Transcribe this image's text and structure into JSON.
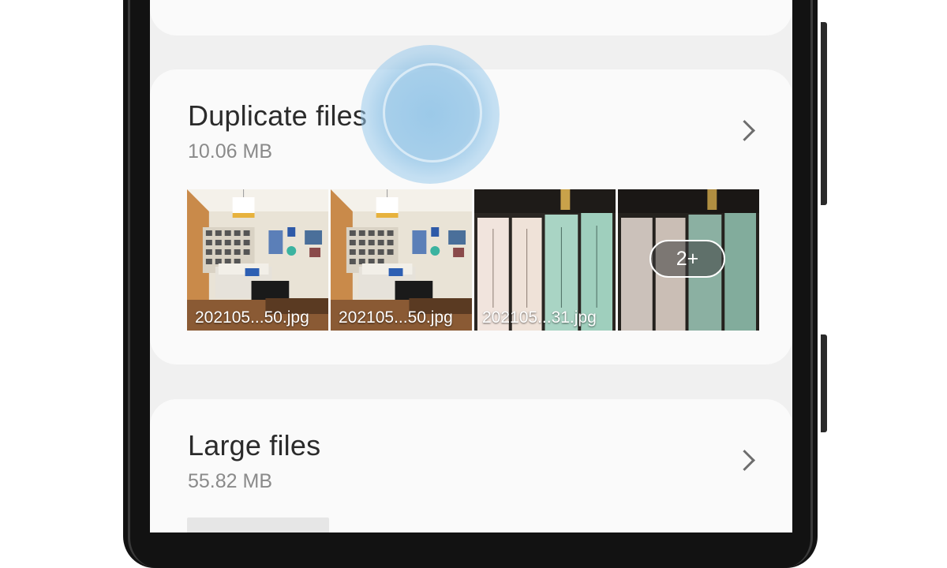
{
  "colors": {
    "screen_bg": "#f0f0f0",
    "card_bg": "#fafafa",
    "title_text": "#2b2b2b",
    "subtitle_text": "#8a8a8a",
    "touch_indicator": "#73b4e1"
  },
  "duplicate_files": {
    "title": "Duplicate files",
    "size": "10.06 MB",
    "thumbnails": [
      {
        "label": "202105...50.jpg",
        "image": "living-room-photo"
      },
      {
        "label": "202105...50.jpg",
        "image": "living-room-photo"
      },
      {
        "label": "202105...31.jpg",
        "image": "books-photo"
      },
      {
        "label": "",
        "image": "books-photo",
        "overflow_badge": "2+"
      }
    ]
  },
  "large_files": {
    "title": "Large files",
    "size": "55.82 MB"
  },
  "icons": {
    "chevron": "chevron-right-icon"
  }
}
